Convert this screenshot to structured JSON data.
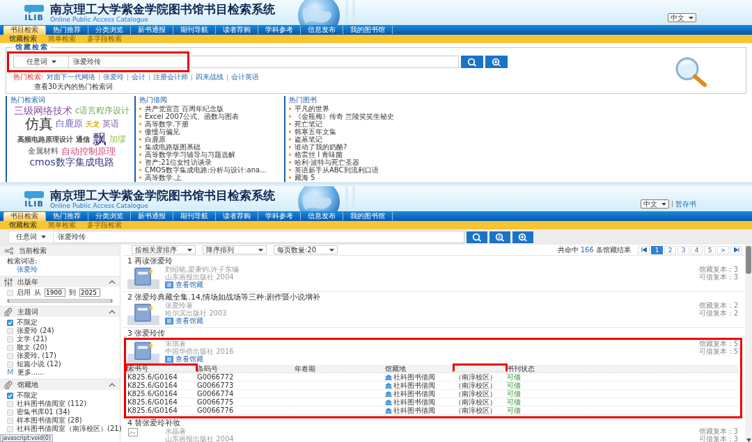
{
  "top_screen": {
    "header": {
      "logo": "ILIB",
      "title": "南京理工大学紫金学院图书馆书目检索系统",
      "subtitle": "Online Public Access Catalogue",
      "language": "中文"
    },
    "nav": [
      {
        "label": "书目检索",
        "selected": true
      },
      {
        "label": "热门推荐",
        "selected": false
      },
      {
        "label": "分类浏览",
        "selected": false
      },
      {
        "label": "新书通报",
        "selected": false
      },
      {
        "label": "期刊导航",
        "selected": false
      },
      {
        "label": "读者荐购",
        "selected": false
      },
      {
        "label": "学科参考",
        "selected": false
      },
      {
        "label": "信息发布",
        "selected": false
      },
      {
        "label": "我的图书馆",
        "selected": false
      }
    ],
    "subnav": [
      {
        "label": "馆藏检索",
        "selected": true
      },
      {
        "label": "简单检索",
        "selected": false
      },
      {
        "label": "多字段检索",
        "selected": false
      }
    ],
    "search_panel": {
      "legend": "馆藏检索",
      "field_type": "任意词",
      "query": "张爱玲传",
      "hot_label": "热门检索:",
      "hot_terms": [
        "对面下一代网络",
        "张爱玲",
        "会计",
        "注册会计师",
        "四来战线",
        "会计英语"
      ],
      "recent_link": "查看30天内的热门检索词"
    },
    "hot_words": {
      "title": "热门检索词",
      "words": [
        {
          "text": "三级网络技术",
          "color": "#8a4fa8"
        },
        {
          "text": "c语言程序设计",
          "color": "#6aa84f"
        },
        {
          "text": "仿真",
          "color": "#333333"
        },
        {
          "text": "白鹿原",
          "color": "#6f64b8"
        },
        {
          "text": "天龙",
          "color": "#d8b820"
        },
        {
          "text": "英语",
          "color": "#7a5a9a"
        },
        {
          "text": "高频电路原理设计",
          "color": "#555555"
        },
        {
          "text": "通信",
          "color": "#444444"
        },
        {
          "text": "飘",
          "color": "#3a2a6a"
        },
        {
          "text": "加缪",
          "color": "#9cc050"
        },
        {
          "text": "金属材料",
          "color": "#555555"
        },
        {
          "text": "自动控制原理",
          "color": "#d04a7a"
        },
        {
          "text": "cmos数字集成电路",
          "color": "#3a3a8a"
        }
      ]
    },
    "hot_loans": {
      "title": "热门借阅",
      "items": [
        "共产党宣言 百周年纪念版",
        "Excel 2007公式、函数与图表",
        "高等数学.下册",
        "傲慢与偏见",
        "白鹿原",
        "集成电路版图基础",
        "高等数学学习辅导与习题选解",
        "资产:21位女性访谈录",
        "CMOS数字集成电路:分析与设计:ana...",
        "高等数学.上"
      ]
    },
    "hot_books": {
      "title": "热门图书",
      "items": [
        "平凡的世界",
        "《金瓶梅》传奇 兰陵笑笑生秘史",
        "死亡笔记",
        "韩寒五年文集",
        "盗墓笔记",
        "谁动了我的奶酪?",
        "格雷丝 I 青味菌",
        "哈利·波特与死亡圣器",
        "英语新手从ABC到流利口语",
        "藏海 5"
      ]
    }
  },
  "bottom_screen": {
    "header": {
      "logo": "ILIB",
      "title": "南京理工大学紫金学院图书馆书目检索系统",
      "subtitle": "Online Public Access Catalogue",
      "language": "中文",
      "shelf_link": "暂存书"
    },
    "nav": [
      {
        "label": "书目检索",
        "selected": true
      },
      {
        "label": "热门推荐",
        "selected": false
      },
      {
        "label": "分类浏览",
        "selected": false
      },
      {
        "label": "新书通报",
        "selected": false
      },
      {
        "label": "期刊导航",
        "selected": false
      },
      {
        "label": "读者荐购",
        "selected": false
      },
      {
        "label": "学科参考",
        "selected": false
      },
      {
        "label": "信息发布",
        "selected": false
      },
      {
        "label": "我的图书馆",
        "selected": false
      }
    ],
    "subnav": [
      {
        "label": "馆藏检索",
        "selected": true
      },
      {
        "label": "简单检索",
        "selected": false
      },
      {
        "label": "多字段检索",
        "selected": false
      }
    ],
    "search": {
      "field_type": "任意词",
      "query": "张爱玲传"
    },
    "sidebar": {
      "current": {
        "title": "当前检索",
        "label": "检索词语:",
        "term": "张爱玲"
      },
      "year": {
        "title": "出版年",
        "enable_label": "启用",
        "enabled": false,
        "from_label": "从",
        "from": "1900",
        "to_label": "到",
        "to": "2025",
        "level": 1
      },
      "facets": [
        {
          "title": "主题词",
          "items": [
            {
              "label": "不限定",
              "checked": true
            },
            {
              "label": "张爱玲 (24)",
              "checked": false
            },
            {
              "label": "文学 (21)",
              "checked": false
            },
            {
              "label": "散文 (20)",
              "checked": false
            },
            {
              "label": "张爱玲, (17)",
              "checked": false
            },
            {
              "label": "短篇小说 (12)",
              "checked": false
            }
          ],
          "more_icon": "M",
          "more": "更多......"
        },
        {
          "title": "馆藏地",
          "items": [
            {
              "label": "不限定",
              "checked": true
            },
            {
              "label": "社科图书借阅室 (112)",
              "checked": false
            },
            {
              "label": "密集书库01 (34)",
              "checked": false
            },
            {
              "label": "样本图书借阅室 (28)",
              "checked": false
            },
            {
              "label": "社科图书借阅室（南淳校区）(21)",
              "checked": false
            }
          ]
        }
      ]
    },
    "toolbar": {
      "sort": "按相关度排序",
      "order": "降序排列",
      "page_size": "每页数量:20",
      "hits_prefix": "共命中",
      "hits": "166",
      "hits_suffix": "条馆藏结果",
      "pages": [
        {
          "label": "1",
          "selected": true
        },
        {
          "label": "2",
          "selected": false
        },
        {
          "label": "3",
          "selected": false
        },
        {
          "label": "4",
          "selected": false
        },
        {
          "label": "5",
          "selected": false
        }
      ],
      "next": ">"
    },
    "results": [
      {
        "number": "1",
        "title": "再读张爱玲",
        "kind": "book",
        "author": "刘绍铭,梁秉钧,许子东编",
        "publisher": "山东画报出版社 2004",
        "holdings_link": "查看馆藏",
        "copies_label": "馆藏复本：",
        "copies": "3",
        "available_label": "可借复本：",
        "available": "3"
      },
      {
        "number": "2",
        "title": "张爱玲典藏全集.14,情场如战场等三种:剧作暨小说增补",
        "kind": "book",
        "author": "张爱玲著",
        "publisher": "哈尔滨出版社 2003",
        "holdings_link": "查看馆藏",
        "copies_label": "馆藏复本：",
        "copies": "2",
        "available_label": "可借复本：",
        "available": "2"
      },
      {
        "number": "3",
        "title": "张爱玲传",
        "kind": "book",
        "author": "宋琪著",
        "publisher": "中国华侨出版社 2016",
        "holdings_link": "查看馆藏",
        "copies_label": "馆藏复本：",
        "copies": "5",
        "available_label": "可借复本：",
        "available": "5",
        "holdings": {
          "columns": [
            "索书号",
            "条码号",
            "年卷期",
            "馆藏地",
            "书刊状态"
          ],
          "rows": [
            {
              "call_number": "K825.6/G0164",
              "barcode": "G0066772",
              "location": "社科图书借阅",
              "campus": "（南淳校区）",
              "status": "可借"
            },
            {
              "call_number": "K825.6/G0164",
              "barcode": "G0066773",
              "location": "社科图书借阅",
              "campus": "（南淳校区）",
              "status": "可借"
            },
            {
              "call_number": "K825.6/G0164",
              "barcode": "G0066774",
              "location": "社科图书借阅",
              "campus": "（南淳校区）",
              "status": "可借"
            },
            {
              "call_number": "K825.6/G0164",
              "barcode": "G0066775",
              "location": "社科图书借阅",
              "campus": "（南淳校区）",
              "status": "可借"
            },
            {
              "call_number": "K825.6/G0164",
              "barcode": "G0066776",
              "location": "社科图书借阅",
              "campus": "（南淳校区）",
              "status": "可借"
            }
          ]
        }
      },
      {
        "number": "4",
        "title": "替张爱玲补妆",
        "kind": "broken_image",
        "author": "水晶著",
        "publisher": "山东画报出版社 2004",
        "copies_label": "馆藏复本：",
        "copies": "3",
        "available_label": "可借复本：",
        "available": "3"
      }
    ],
    "status_tip": "javascript:void(0)"
  }
}
